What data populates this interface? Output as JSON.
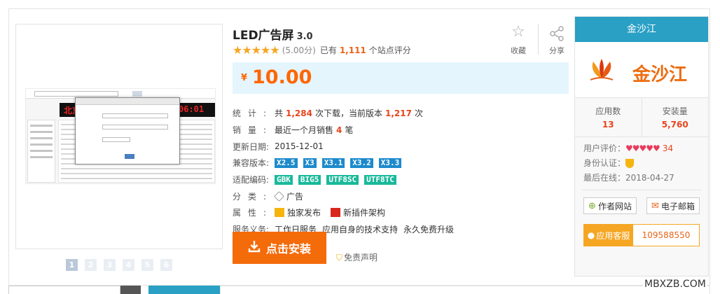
{
  "product": {
    "title": "LED广告屏",
    "version": "3.0",
    "score": "(5.00分)",
    "rating_pre": "已有",
    "rating_count": "1,111",
    "rating_post": "个站点评分",
    "stars": "★★★★★",
    "rating_value": 5.0
  },
  "actions": {
    "favorite": "收藏",
    "share": "分享"
  },
  "price": {
    "currency": "¥",
    "amount": "10.00"
  },
  "info": {
    "stats_label": "统计:",
    "stats_pre": "共",
    "downloads": "1,284",
    "stats_mid": "次下载，当前版本",
    "current_version_downloads": "1,217",
    "stats_post": "次",
    "sales_label": "销量:",
    "sales_pre": "最近一个月销售",
    "sales_count": "4",
    "sales_post": "笔",
    "updated_label": "更新日期:",
    "updated_date": "2015-12-01",
    "compat_label": "兼容版本:",
    "compat_versions": [
      "X2.5",
      "X3",
      "X3.1",
      "X3.2",
      "X3.3"
    ],
    "encoding_label": "适配编码:",
    "encodings": [
      "GBK",
      "BIG5",
      "UTF8SC",
      "UTF8TC"
    ],
    "category_label": "分类:",
    "category": "广告",
    "attr_label": "属性:",
    "attrs": [
      "独家发布",
      "新插件架构"
    ],
    "service_label": "服务义务:",
    "services": [
      "工作日服务",
      "应用自身的技术支持",
      "永久免费升级"
    ]
  },
  "install": {
    "label": "点击安装",
    "disclaimer": "免责声明"
  },
  "gallery": {
    "thumbs": [
      "1",
      "2",
      "3",
      "4",
      "5",
      "6"
    ],
    "active_index": 0,
    "led_text": "北京",
    "led_clock": "06:01"
  },
  "developer": {
    "name": "金沙江",
    "logo_text": "金沙江",
    "apps_label": "应用数",
    "apps_count": "13",
    "installs_label": "安装量",
    "installs_count": "5,760",
    "user_rating_label": "用户评价：",
    "hearts": "♥♥♥♥♥",
    "rating_num": "34",
    "verify_label": "身份认证：",
    "last_online_label": "最后在线：",
    "last_online": "2018-04-27",
    "site_label": "作者网站",
    "email_label": "电子邮箱",
    "service_label": "应用客服",
    "service_qq": "109588550"
  },
  "colors": {
    "accent": "#29a0c4",
    "price": "#ff6600",
    "install": "#f46b0a",
    "highlight": "#e8441b",
    "tag_blue": "#1d8acc",
    "tag_green": "#19b99a"
  },
  "watermark": "MBXZB.COM"
}
